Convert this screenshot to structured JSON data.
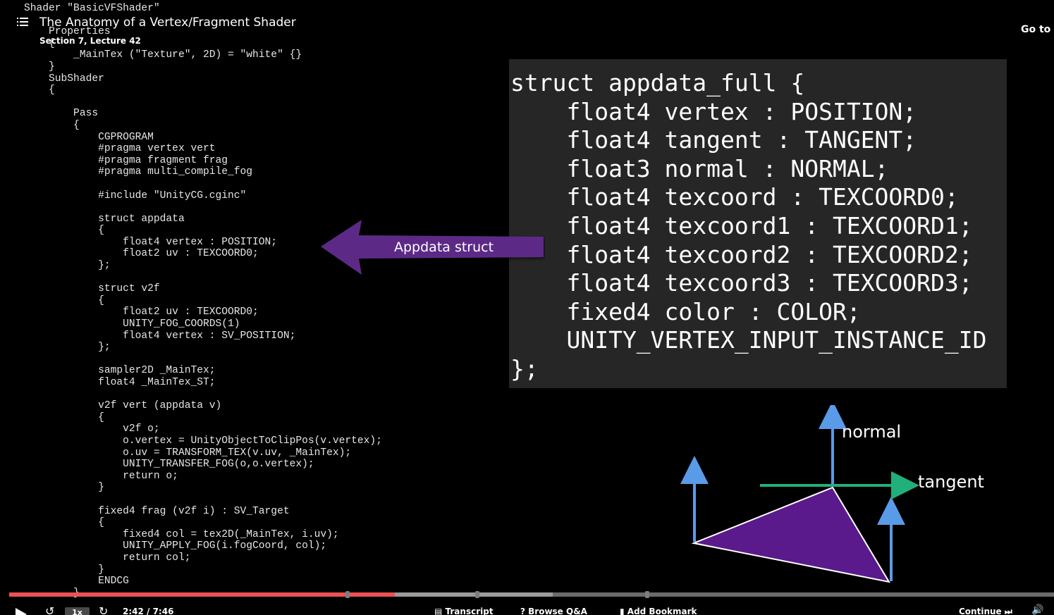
{
  "header": {
    "menu_icon": "list-menu-icon",
    "title": "The Anatomy of a Vertex/Fragment Shader",
    "subtitle": "Section 7, Lecture 42",
    "goto_label": "Go to l"
  },
  "code_lines": [
    "Shader \"BasicVFShader\"",
    "",
    "    Properties",
    "    {",
    "        _MainTex (\"Texture\", 2D) = \"white\" {}",
    "    }",
    "    SubShader",
    "    {",
    "",
    "        Pass",
    "        {",
    "            CGPROGRAM",
    "            #pragma vertex vert",
    "            #pragma fragment frag",
    "            #pragma multi_compile_fog",
    "",
    "            #include \"UnityCG.cginc\"",
    "",
    "            struct appdata",
    "            {",
    "                float4 vertex : POSITION;",
    "                float2 uv : TEXCOORD0;",
    "            };",
    "",
    "            struct v2f",
    "            {",
    "                float2 uv : TEXCOORD0;",
    "                UNITY_FOG_COORDS(1)",
    "                float4 vertex : SV_POSITION;",
    "            };",
    "",
    "            sampler2D _MainTex;",
    "            float4 _MainTex_ST;",
    "",
    "            v2f vert (appdata v)",
    "            {",
    "                v2f o;",
    "                o.vertex = UnityObjectToClipPos(v.vertex);",
    "                o.uv = TRANSFORM_TEX(v.uv, _MainTex);",
    "                UNITY_TRANSFER_FOG(o,o.vertex);",
    "                return o;",
    "            }",
    "",
    "            fixed4 frag (v2f i) : SV_Target",
    "            {",
    "                fixed4 col = tex2D(_MainTex, i.uv);",
    "                UNITY_APPLY_FOG(i.fogCoord, col);",
    "                return col;",
    "            }",
    "            ENDCG",
    "        }"
  ],
  "struct_panel": {
    "lines": [
      "struct appdata_full {",
      "    float4 vertex : POSITION;",
      "    float4 tangent : TANGENT;",
      "    float3 normal : NORMAL;",
      "    float4 texcoord : TEXCOORD0;",
      "    float4 texcoord1 : TEXCOORD1;",
      "    float4 texcoord2 : TEXCOORD2;",
      "    float4 texcoord3 : TEXCOORD3;",
      "    fixed4 color : COLOR;",
      "    UNITY_VERTEX_INPUT_INSTANCE_ID",
      "};"
    ]
  },
  "callout": {
    "label": "Appdata struct",
    "color": "#5b2a86"
  },
  "diagram": {
    "normal_label": "normal",
    "tangent_label": "tangent",
    "triangle_color": "#5a1a8c",
    "normal_color": "#5a9be8",
    "tangent_color": "#22b07a"
  },
  "player": {
    "time": "2:42 / 7:46",
    "speed": "1x",
    "progress_fraction": 0.369,
    "buffered_fraction": 0.52,
    "transcript_label": "Transcript",
    "qa_label": "Browse Q&A",
    "bookmark_label": "Add Bookmark",
    "continue_label": "Continue",
    "colors": {
      "played": "#ec5252",
      "buffered": "#9a9a9a",
      "track": "#6b6b6b"
    }
  }
}
